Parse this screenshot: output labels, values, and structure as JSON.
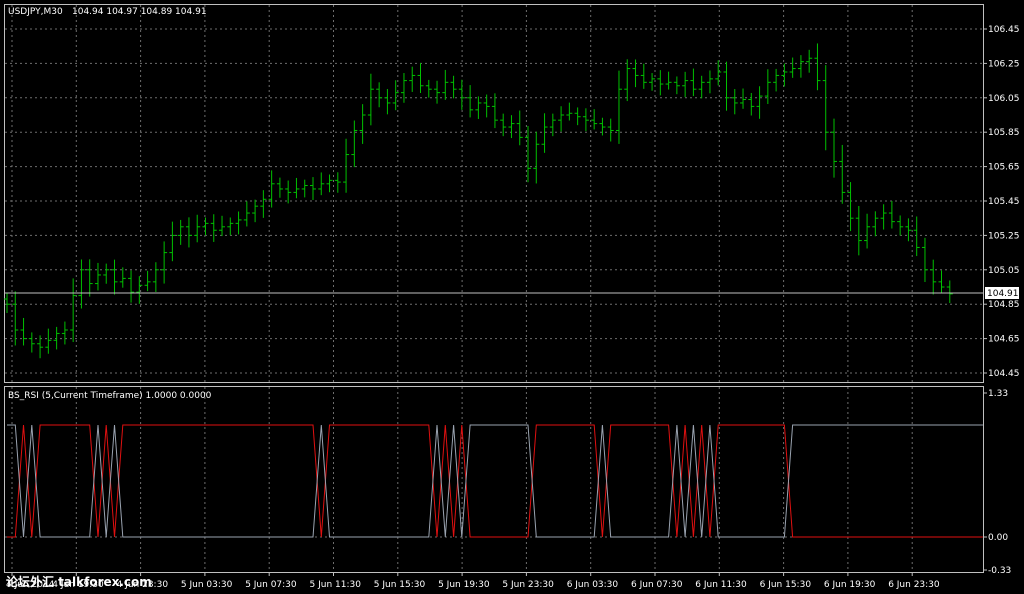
{
  "main_chart": {
    "symbol_label": "USDJPY,M30",
    "ohlc_label": "104.94 104.97 104.89 104.91",
    "current_price": "104.91",
    "price_ticks": [
      "106.45",
      "106.25",
      "106.05",
      "105.85",
      "105.65",
      "105.45",
      "105.25",
      "105.05",
      "104.85",
      "104.65",
      "104.45"
    ]
  },
  "indicator": {
    "label": "BS_RSI (5,Current Timeframe) 1.0000 0.0000",
    "ticks": [
      "1.33",
      "0.00",
      "-0.33"
    ]
  },
  "time_axis": {
    "labels": [
      "4 Jun 2014",
      "4 Jun 19:30",
      "4 Jun 23:30",
      "5 Jun 03:30",
      "5 Jun 07:30",
      "5 Jun 11:30",
      "5 Jun 15:30",
      "5 Jun 19:30",
      "5 Jun 23:30",
      "6 Jun 03:30",
      "6 Jun 07:30",
      "6 Jun 11:30",
      "6 Jun 15:30",
      "6 Jun 19:30",
      "6 Jun 23:30"
    ]
  },
  "watermark": "论坛外汇 talkforex.com",
  "colors": {
    "bar": "#00c000",
    "grid": "#6e6e6e",
    "rsi_red": "#e01010",
    "rsi_gray": "#9aa3b0",
    "frame": "#c0c0c0"
  },
  "chart_data": [
    {
      "type": "ohlc",
      "title": "USDJPY,M30",
      "ylim": [
        104.4,
        106.5
      ],
      "close": [
        104.85,
        104.7,
        104.65,
        104.62,
        104.6,
        104.64,
        104.68,
        104.7,
        104.9,
        105.05,
        104.97,
        105.02,
        105.05,
        104.98,
        105.0,
        104.92,
        104.96,
        104.98,
        105.05,
        105.15,
        105.25,
        105.3,
        105.25,
        105.3,
        105.32,
        105.28,
        105.3,
        105.32,
        105.34,
        105.38,
        105.42,
        105.46,
        105.55,
        105.52,
        105.5,
        105.52,
        105.54,
        105.52,
        105.55,
        105.57,
        105.56,
        105.72,
        105.86,
        105.95,
        106.1,
        106.05,
        106.02,
        106.08,
        106.15,
        106.18,
        106.12,
        106.1,
        106.08,
        106.14,
        106.1,
        106.05,
        105.98,
        106.02,
        106.0,
        105.92,
        105.88,
        105.9,
        105.82,
        105.64,
        105.78,
        105.88,
        105.92,
        105.95,
        105.96,
        105.94,
        105.92,
        105.9,
        105.88,
        105.86,
        106.1,
        106.22,
        106.18,
        106.14,
        106.16,
        106.13,
        106.14,
        106.12,
        106.15,
        106.1,
        106.14,
        106.16,
        106.2,
        106.05,
        106.02,
        106.04,
        106.0,
        106.06,
        106.14,
        106.18,
        106.2,
        106.22,
        106.26,
        106.28,
        106.15,
        105.85,
        105.68,
        105.5,
        105.35,
        105.22,
        105.3,
        105.35,
        105.38,
        105.33,
        105.3,
        105.28,
        105.18,
        105.05,
        104.98,
        104.95,
        104.91
      ]
    },
    {
      "type": "line",
      "title": "BS_RSI (5,Current Timeframe) 1.0000 0.0000",
      "ylim": [
        -0.33,
        1.33
      ],
      "series": [
        {
          "values": [
            0,
            0,
            1,
            0,
            1,
            1,
            1,
            1,
            1,
            1,
            1,
            0,
            1,
            0,
            1,
            1,
            1,
            1,
            1,
            1,
            1,
            1,
            1,
            1,
            1,
            1,
            1,
            1,
            1,
            1,
            1,
            1,
            1,
            1,
            1,
            1,
            1,
            1,
            0,
            1,
            1,
            1,
            1,
            1,
            1,
            1,
            1,
            1,
            1,
            1,
            1,
            1,
            0,
            1,
            0,
            1,
            0,
            0,
            0,
            0,
            0,
            0,
            0,
            0,
            1,
            1,
            1,
            1,
            1,
            1,
            1,
            1,
            0,
            1,
            1,
            1,
            1,
            1,
            1,
            1,
            1,
            0,
            1,
            0,
            1,
            0,
            1,
            1,
            1,
            1,
            1,
            1,
            1,
            1,
            1,
            0,
            0,
            0,
            0,
            0,
            0,
            0,
            0,
            0,
            0,
            0,
            0,
            0,
            0,
            0,
            0,
            0,
            0,
            0,
            0,
            0,
            0,
            0,
            0
          ]
        },
        {
          "values": [
            1,
            1,
            0,
            1,
            0,
            0,
            0,
            0,
            0,
            0,
            0,
            1,
            0,
            1,
            0,
            0,
            0,
            0,
            0,
            0,
            0,
            0,
            0,
            0,
            0,
            0,
            0,
            0,
            0,
            0,
            0,
            0,
            0,
            0,
            0,
            0,
            0,
            0,
            1,
            0,
            0,
            0,
            0,
            0,
            0,
            0,
            0,
            0,
            0,
            0,
            0,
            0,
            1,
            0,
            1,
            0,
            1,
            1,
            1,
            1,
            1,
            1,
            1,
            1,
            0,
            0,
            0,
            0,
            0,
            0,
            0,
            0,
            1,
            0,
            0,
            0,
            0,
            0,
            0,
            0,
            0,
            1,
            0,
            1,
            0,
            1,
            0,
            0,
            0,
            0,
            0,
            0,
            0,
            0,
            0,
            1,
            1,
            1,
            1,
            1,
            1,
            1,
            1,
            1,
            1,
            1,
            1,
            1,
            1,
            1,
            1,
            1,
            1,
            1,
            1,
            1,
            1,
            1,
            1
          ]
        }
      ]
    }
  ]
}
